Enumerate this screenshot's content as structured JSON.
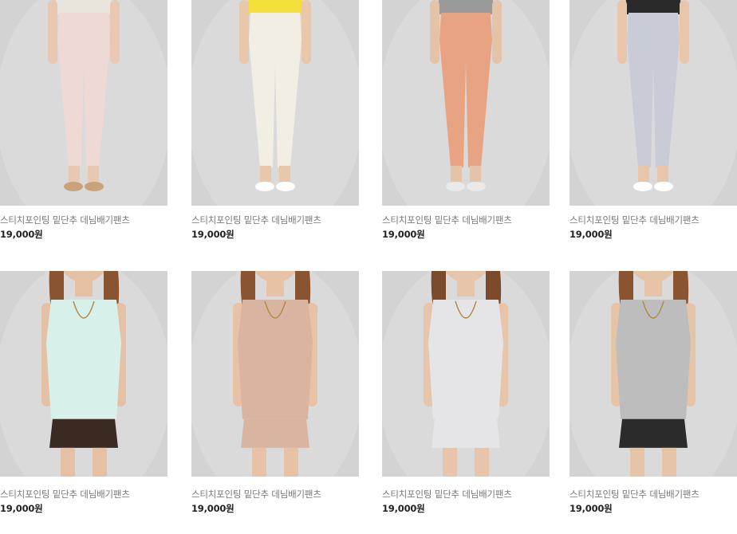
{
  "products": [
    {
      "name": "스티치포인팅 밑단추 데님배기팬츠",
      "price": "19,000원",
      "garment": "pale pink skinny jeans",
      "top_color": "#e9e4dc",
      "bottom_color": "#efd9d5",
      "skin": "#e8c8b0",
      "hair": "#6b4630",
      "shoe": "#c9a27a"
    },
    {
      "name": "스티치포인팅 밑단추 데님배기팬츠",
      "price": "19,000원",
      "garment": "yellow tank top",
      "top_color": "#f4df3a",
      "bottom_color": "#f2eee4",
      "skin": "#e9c7ab",
      "hair": "#6a3b22",
      "shoe": "#ffffff"
    },
    {
      "name": "스티치포인팅 밑단추 데님배기팬츠",
      "price": "19,000원",
      "garment": "orange tie-dye pants",
      "top_color": "#9a9a9a",
      "bottom_color": "#e8a383",
      "skin": "#e5c3a8",
      "hair": "#6b4630",
      "shoe": "#e9e9e9"
    },
    {
      "name": "스티치포인팅 밑단추 데님배기팬츠",
      "price": "19,000원",
      "garment": "black sheer top",
      "top_color": "#2a2a2a",
      "bottom_color": "#c9ccd6",
      "skin": "#e9c6aa",
      "hair": "#9a4b22",
      "shoe": "#ffffff"
    },
    {
      "name": "스티치포인팅 밑단추 데님배기팬츠",
      "price": "19,000원",
      "garment": "mint striped top",
      "top_color": "#d8f0ea",
      "bottom_color": "#3a2a22",
      "skin": "#e4c1a4",
      "hair": "#8a5430",
      "shoe": "#ffffff"
    },
    {
      "name": "스티치포인팅 밑단추 데님배기팬츠",
      "price": "19,000원",
      "garment": "polka dot dress",
      "top_color": "#d8b4a1",
      "bottom_color": "#d8b4a1",
      "skin": "#e7c2a6",
      "hair": "#8a5430",
      "shoe": "#ffffff"
    },
    {
      "name": "스티치포인팅 밑단추 데님배기팬츠",
      "price": "19,000원",
      "garment": "grey striped dress",
      "top_color": "#e5e5e8",
      "bottom_color": "#e5e5e8",
      "skin": "#e6c5aa",
      "hair": "#7a4a2a",
      "shoe": "#ffffff"
    },
    {
      "name": "스티치포인팅 밑단추 데님배기팬츠",
      "price": "19,000원",
      "garment": "grey tee with black bow",
      "top_color": "#bdbdbd",
      "bottom_color": "#2b2b2b",
      "skin": "#e6c4a7",
      "hair": "#8a5430",
      "shoe": "#ffffff"
    }
  ]
}
